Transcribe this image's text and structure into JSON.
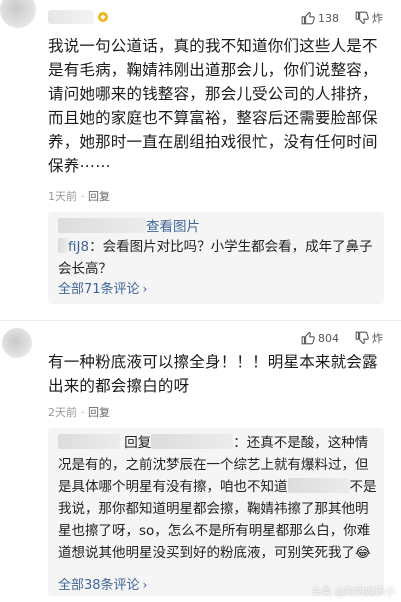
{
  "comments": [
    {
      "like_count": "138",
      "dislike_label": "炸",
      "text": "我说一句公道话，真的我不知道你们这些人是不是有毛病，鞠婧祎刚出道那会儿，你们说整容，请问她哪来的钱整容，那会儿受公司的人排挤，而且她的家庭也不算富裕，整容后还需要脸部保养，她那时一直在剧组拍戏很忙，没有任何时间保养⋯⋯",
      "time": "1天前",
      "reply_label": "回复",
      "replies": [
        {
          "link_text": "查看图片",
          "user_suffix": "fiJ8",
          "text": "会看图片对比吗？小学生都会看，成年了鼻子会长高？"
        }
      ],
      "view_all_label": "全部71条评论"
    },
    {
      "like_count": "804",
      "dislike_label": "炸",
      "text": "有一种粉底液可以擦全身！！！明星本来就会露出来的都会擦白的呀",
      "time": "2天前",
      "reply_label": "回复",
      "replies": [
        {
          "reply_word": "回复",
          "text_part1": "还真不是酸，这种情况是有的，之前沈梦辰在一个综艺上就有爆料过，但是具体哪个明星有没有擦，咱也不知道",
          "text_part2": "不是我说，那你都知道明星都会擦，鞠婧祎擦了那其他明星也擦了呀，so，怎么不是所有明星都那么白，你难道想说其他明星没买到好的粉底液，可别笑死我了",
          "emoji": "😂"
        }
      ],
      "view_all_label": "全部38条评论"
    }
  ],
  "watermark": "头条 @时尚娱乐小",
  "colors": {
    "link": "#406599",
    "meta": "#999999",
    "reply_bg": "#f5f5f5"
  }
}
